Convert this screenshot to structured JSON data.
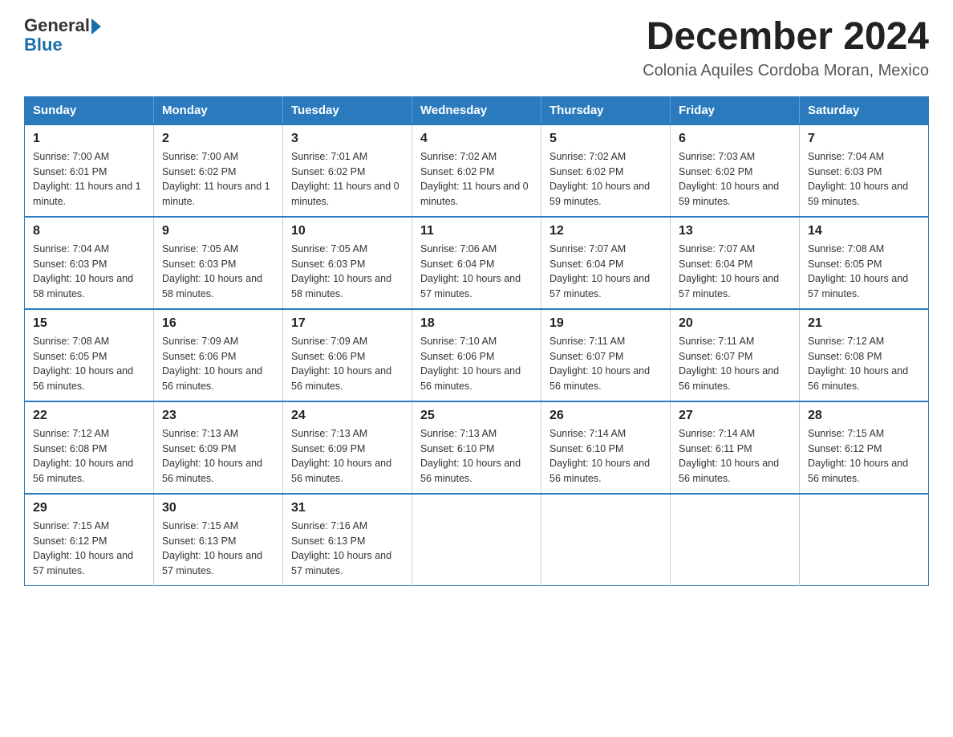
{
  "header": {
    "logo_general": "General",
    "logo_blue": "Blue",
    "title": "December 2024",
    "subtitle": "Colonia Aquiles Cordoba Moran, Mexico"
  },
  "days_of_week": [
    "Sunday",
    "Monday",
    "Tuesday",
    "Wednesday",
    "Thursday",
    "Friday",
    "Saturday"
  ],
  "weeks": [
    [
      {
        "day": "1",
        "sunrise": "7:00 AM",
        "sunset": "6:01 PM",
        "daylight": "11 hours and 1 minute."
      },
      {
        "day": "2",
        "sunrise": "7:00 AM",
        "sunset": "6:02 PM",
        "daylight": "11 hours and 1 minute."
      },
      {
        "day": "3",
        "sunrise": "7:01 AM",
        "sunset": "6:02 PM",
        "daylight": "11 hours and 0 minutes."
      },
      {
        "day": "4",
        "sunrise": "7:02 AM",
        "sunset": "6:02 PM",
        "daylight": "11 hours and 0 minutes."
      },
      {
        "day": "5",
        "sunrise": "7:02 AM",
        "sunset": "6:02 PM",
        "daylight": "10 hours and 59 minutes."
      },
      {
        "day": "6",
        "sunrise": "7:03 AM",
        "sunset": "6:02 PM",
        "daylight": "10 hours and 59 minutes."
      },
      {
        "day": "7",
        "sunrise": "7:04 AM",
        "sunset": "6:03 PM",
        "daylight": "10 hours and 59 minutes."
      }
    ],
    [
      {
        "day": "8",
        "sunrise": "7:04 AM",
        "sunset": "6:03 PM",
        "daylight": "10 hours and 58 minutes."
      },
      {
        "day": "9",
        "sunrise": "7:05 AM",
        "sunset": "6:03 PM",
        "daylight": "10 hours and 58 minutes."
      },
      {
        "day": "10",
        "sunrise": "7:05 AM",
        "sunset": "6:03 PM",
        "daylight": "10 hours and 58 minutes."
      },
      {
        "day": "11",
        "sunrise": "7:06 AM",
        "sunset": "6:04 PM",
        "daylight": "10 hours and 57 minutes."
      },
      {
        "day": "12",
        "sunrise": "7:07 AM",
        "sunset": "6:04 PM",
        "daylight": "10 hours and 57 minutes."
      },
      {
        "day": "13",
        "sunrise": "7:07 AM",
        "sunset": "6:04 PM",
        "daylight": "10 hours and 57 minutes."
      },
      {
        "day": "14",
        "sunrise": "7:08 AM",
        "sunset": "6:05 PM",
        "daylight": "10 hours and 57 minutes."
      }
    ],
    [
      {
        "day": "15",
        "sunrise": "7:08 AM",
        "sunset": "6:05 PM",
        "daylight": "10 hours and 56 minutes."
      },
      {
        "day": "16",
        "sunrise": "7:09 AM",
        "sunset": "6:06 PM",
        "daylight": "10 hours and 56 minutes."
      },
      {
        "day": "17",
        "sunrise": "7:09 AM",
        "sunset": "6:06 PM",
        "daylight": "10 hours and 56 minutes."
      },
      {
        "day": "18",
        "sunrise": "7:10 AM",
        "sunset": "6:06 PM",
        "daylight": "10 hours and 56 minutes."
      },
      {
        "day": "19",
        "sunrise": "7:11 AM",
        "sunset": "6:07 PM",
        "daylight": "10 hours and 56 minutes."
      },
      {
        "day": "20",
        "sunrise": "7:11 AM",
        "sunset": "6:07 PM",
        "daylight": "10 hours and 56 minutes."
      },
      {
        "day": "21",
        "sunrise": "7:12 AM",
        "sunset": "6:08 PM",
        "daylight": "10 hours and 56 minutes."
      }
    ],
    [
      {
        "day": "22",
        "sunrise": "7:12 AM",
        "sunset": "6:08 PM",
        "daylight": "10 hours and 56 minutes."
      },
      {
        "day": "23",
        "sunrise": "7:13 AM",
        "sunset": "6:09 PM",
        "daylight": "10 hours and 56 minutes."
      },
      {
        "day": "24",
        "sunrise": "7:13 AM",
        "sunset": "6:09 PM",
        "daylight": "10 hours and 56 minutes."
      },
      {
        "day": "25",
        "sunrise": "7:13 AM",
        "sunset": "6:10 PM",
        "daylight": "10 hours and 56 minutes."
      },
      {
        "day": "26",
        "sunrise": "7:14 AM",
        "sunset": "6:10 PM",
        "daylight": "10 hours and 56 minutes."
      },
      {
        "day": "27",
        "sunrise": "7:14 AM",
        "sunset": "6:11 PM",
        "daylight": "10 hours and 56 minutes."
      },
      {
        "day": "28",
        "sunrise": "7:15 AM",
        "sunset": "6:12 PM",
        "daylight": "10 hours and 56 minutes."
      }
    ],
    [
      {
        "day": "29",
        "sunrise": "7:15 AM",
        "sunset": "6:12 PM",
        "daylight": "10 hours and 57 minutes."
      },
      {
        "day": "30",
        "sunrise": "7:15 AM",
        "sunset": "6:13 PM",
        "daylight": "10 hours and 57 minutes."
      },
      {
        "day": "31",
        "sunrise": "7:16 AM",
        "sunset": "6:13 PM",
        "daylight": "10 hours and 57 minutes."
      },
      null,
      null,
      null,
      null
    ]
  ],
  "labels": {
    "sunrise": "Sunrise:",
    "sunset": "Sunset:",
    "daylight": "Daylight:"
  }
}
